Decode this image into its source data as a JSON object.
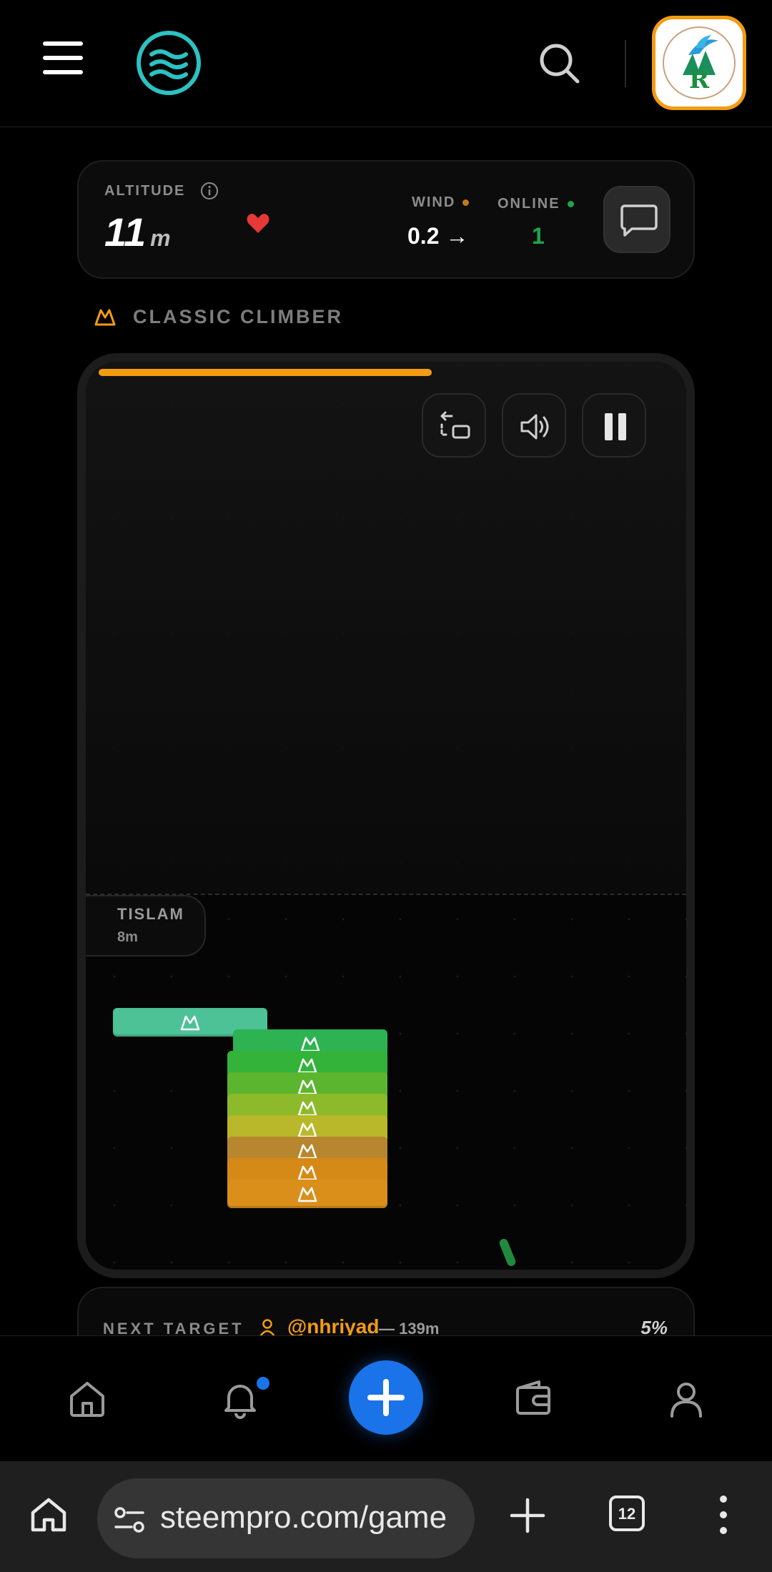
{
  "header": {
    "menu_icon": "hamburger-icon",
    "logo_icon": "waves-logo-icon",
    "search_icon": "search-icon",
    "avatar_icon": "bird-logo-avatar-icon",
    "avatar_border_color": "#f39c12"
  },
  "stats": {
    "altitude_label": "ALTITUDE",
    "altitude_value": "11",
    "altitude_unit": "m",
    "wind_label": "WIND",
    "wind_value": "0.2 →",
    "online_label": "ONLINE",
    "online_value": "1",
    "colors": {
      "wind_dot": "#c07a1c",
      "online_dot": "#1fa54a",
      "heart": "#e53935"
    }
  },
  "mode": {
    "label": "CLASSIC CLIMBER",
    "icon": "mountain-icon"
  },
  "game": {
    "progress": 0.71,
    "progress_color": "#f39c12",
    "controls": [
      "switch-camera-icon",
      "volume-icon",
      "pause-icon"
    ],
    "player_tag": {
      "name": "TISLAM",
      "altitude": "8m"
    },
    "block_colors": [
      "#4cc296",
      "#2db352",
      "#33b33a",
      "#5cb52e",
      "#8cba2a",
      "#b8b82a",
      "#b8862e",
      "#d58a17",
      "#d98f1a"
    ]
  },
  "next_target": {
    "label": "NEXT TARGET",
    "user": "@nhriyad",
    "distance": "— 139m",
    "percent": "5%"
  },
  "bottom_nav": {
    "items": [
      "home-icon",
      "bell-icon",
      "plus-icon",
      "wallet-icon",
      "profile-icon"
    ],
    "notification_color": "#1a73e8"
  },
  "browser": {
    "url": "steempro.com/game",
    "tab_count": "12"
  }
}
